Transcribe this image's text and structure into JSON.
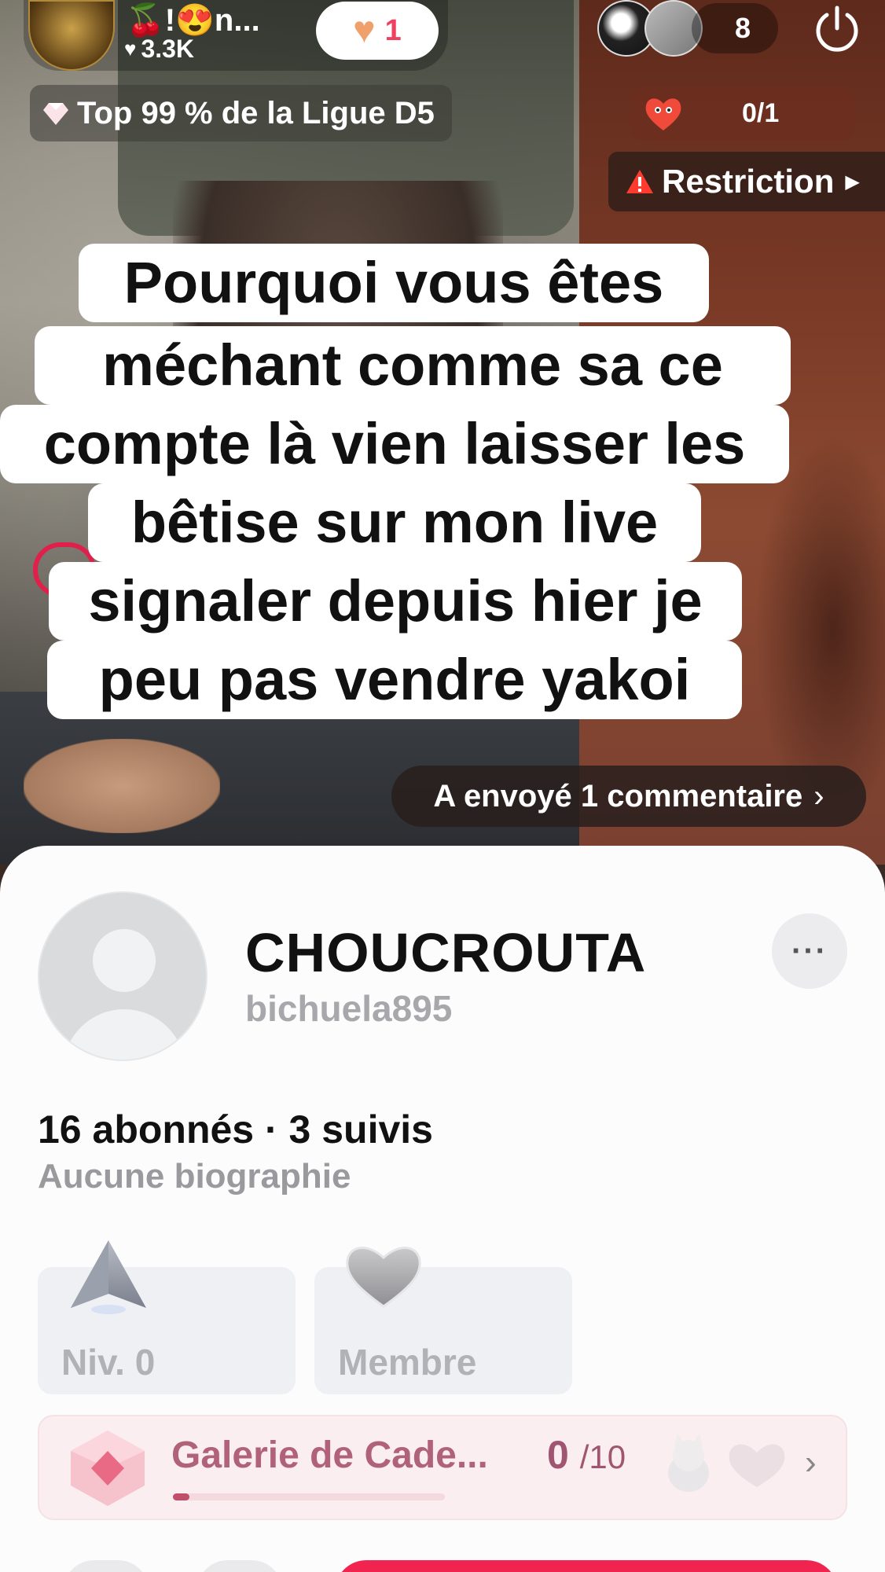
{
  "host": {
    "name": "🍒!😍n...",
    "likes": "3.3K",
    "follow_count": "1"
  },
  "viewers": {
    "count": "8"
  },
  "league": {
    "text": "Top 99 % de la Ligue D5"
  },
  "goal": {
    "progress": "0/1"
  },
  "restriction": {
    "label": "Restriction"
  },
  "caption": {
    "lines": [
      "Pourquoi vous êtes",
      "méchant comme sa ce",
      "compte là vien laisser les",
      "bêtise sur mon live",
      "signaler depuis hier je",
      "peu pas vendre yakoi"
    ]
  },
  "comment_notice": {
    "label": "A envoyé 1 commentaire"
  },
  "profile": {
    "display_name": "CHOUCROUTA",
    "username": "bichuela895",
    "stats": "16 abonnés · 3 suivis",
    "bio": "Aucune biographie",
    "more_label": "···"
  },
  "badges": [
    {
      "icon": "level-arrow-icon",
      "label": "Niv. 0"
    },
    {
      "icon": "member-heart-icon",
      "label": "Membre"
    }
  ],
  "gift_gallery": {
    "title": "Galerie de Cade...",
    "collected": "0",
    "total": "/10",
    "progress_fraction": 0.06
  },
  "colors": {
    "accent": "#f0244e",
    "gallery_text": "#b06278",
    "follow_count": "#f04060"
  }
}
